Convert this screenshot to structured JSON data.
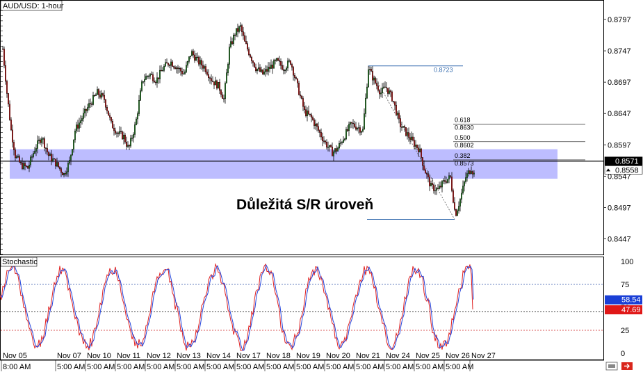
{
  "chart_data": [
    {
      "type": "candlestick",
      "title": "AUD/USD: 1-hour",
      "ylim": [
        0.8422,
        0.8827
      ],
      "y_ticks": [
        "0.8797",
        "0.8747",
        "0.8697",
        "0.8647",
        "0.8597",
        "0.8547",
        "0.8497",
        "0.8447"
      ],
      "x_labels": [
        "Nov 05",
        "Nov 07",
        "Nov 10",
        "Nov 11",
        "Nov 12",
        "Nov 13",
        "Nov 14",
        "Nov 17",
        "Nov 18",
        "Nov 19",
        "Nov 20",
        "Nov 21",
        "Nov 24",
        "Nov 25",
        "Nov 26",
        "Nov 27"
      ],
      "time_labels": [
        "8:00 AM",
        "5:00 AM",
        "5:00 AM",
        "5:00 AM",
        "5:00 AM",
        "5:00 AM",
        "5:00 AM",
        "5:00 AM",
        "5:00 AM",
        "5:00 AM",
        "5:00 AM",
        "5:00 AM",
        "5:00 AM",
        "5:00 AM",
        "5:00 AM"
      ],
      "price_path": [
        [
          0,
          0.8745
        ],
        [
          4,
          0.875
        ],
        [
          10,
          0.868
        ],
        [
          16,
          0.862
        ],
        [
          22,
          0.858
        ],
        [
          30,
          0.8565
        ],
        [
          40,
          0.856
        ],
        [
          50,
          0.859
        ],
        [
          60,
          0.861
        ],
        [
          70,
          0.858
        ],
        [
          80,
          0.8568
        ],
        [
          92,
          0.855
        ],
        [
          100,
          0.857
        ],
        [
          108,
          0.862
        ],
        [
          118,
          0.864
        ],
        [
          128,
          0.866
        ],
        [
          140,
          0.868
        ],
        [
          150,
          0.867
        ],
        [
          160,
          0.863
        ],
        [
          170,
          0.8615
        ],
        [
          178,
          0.861
        ],
        [
          185,
          0.859
        ],
        [
          195,
          0.863
        ],
        [
          205,
          0.87
        ],
        [
          215,
          0.871
        ],
        [
          225,
          0.87
        ],
        [
          235,
          0.872
        ],
        [
          245,
          0.873
        ],
        [
          255,
          0.872
        ],
        [
          265,
          0.871
        ],
        [
          275,
          0.8745
        ],
        [
          285,
          0.873
        ],
        [
          295,
          0.872
        ],
        [
          305,
          0.87
        ],
        [
          315,
          0.869
        ],
        [
          322,
          0.867
        ],
        [
          330,
          0.875
        ],
        [
          338,
          0.8775
        ],
        [
          346,
          0.8785
        ],
        [
          352,
          0.876
        ],
        [
          360,
          0.874
        ],
        [
          368,
          0.872
        ],
        [
          378,
          0.871
        ],
        [
          388,
          0.872
        ],
        [
          398,
          0.873
        ],
        [
          408,
          0.872
        ],
        [
          418,
          0.873
        ],
        [
          428,
          0.869
        ],
        [
          438,
          0.865
        ],
        [
          448,
          0.864
        ],
        [
          458,
          0.862
        ],
        [
          468,
          0.86
        ],
        [
          478,
          0.8585
        ],
        [
          485,
          0.859
        ],
        [
          495,
          0.861
        ],
        [
          505,
          0.863
        ],
        [
          515,
          0.8625
        ],
        [
          522,
          0.862
        ],
        [
          530,
          0.872
        ],
        [
          538,
          0.87
        ],
        [
          548,
          0.868
        ],
        [
          555,
          0.869
        ],
        [
          565,
          0.867
        ],
        [
          575,
          0.863
        ],
        [
          585,
          0.8615
        ],
        [
          595,
          0.86
        ],
        [
          603,
          0.859
        ],
        [
          610,
          0.856
        ],
        [
          620,
          0.853
        ],
        [
          630,
          0.8525
        ],
        [
          640,
          0.854
        ],
        [
          648,
          0.8545
        ],
        [
          655,
          0.8485
        ],
        [
          662,
          0.851
        ],
        [
          670,
          0.8545
        ],
        [
          678,
          0.856
        ],
        [
          682,
          0.855
        ]
      ],
      "hlines": [
        {
          "label": "0.8723",
          "value": 0.8723,
          "color": "#3a6fb0"
        },
        {
          "label": "0.618",
          "value2": "0.8630",
          "value": 0.863,
          "color": "#444444"
        },
        {
          "label": "0.500",
          "value2": "0.8602",
          "value": 0.8602,
          "color": "#444444"
        },
        {
          "label": "0.382",
          "value2": "0.8573",
          "value": 0.8573,
          "color": "#444444"
        }
      ],
      "zone": {
        "top": 0.859,
        "bottom": 0.8543,
        "color": "#9999ff"
      },
      "sr_level": 0.8571,
      "annotation": "Důležitá S/R úroveň",
      "price_badges": [
        {
          "label": "0.8571",
          "value": 0.8571,
          "bg": "#000000",
          "fg": "#ffffff"
        },
        {
          "label": "0.8558",
          "value": 0.8558,
          "bg": "#ffffff",
          "fg": "#000000"
        }
      ],
      "fib_anchor_high": 0.8723,
      "fib_anchor_low": 0.8478
    },
    {
      "type": "line",
      "title": "Stochastic",
      "ylim": [
        0,
        100
      ],
      "y_ticks": [
        "100",
        "75",
        "50",
        "25",
        "0"
      ],
      "levels": [
        75,
        45,
        25
      ],
      "series": [
        {
          "color": "#2244dd",
          "current": "58.54"
        },
        {
          "color": "#e02020",
          "current": "47.69"
        }
      ]
    }
  ],
  "scrollbar_icon": "scroll-icon",
  "close_icon": "close-arrow-icon"
}
